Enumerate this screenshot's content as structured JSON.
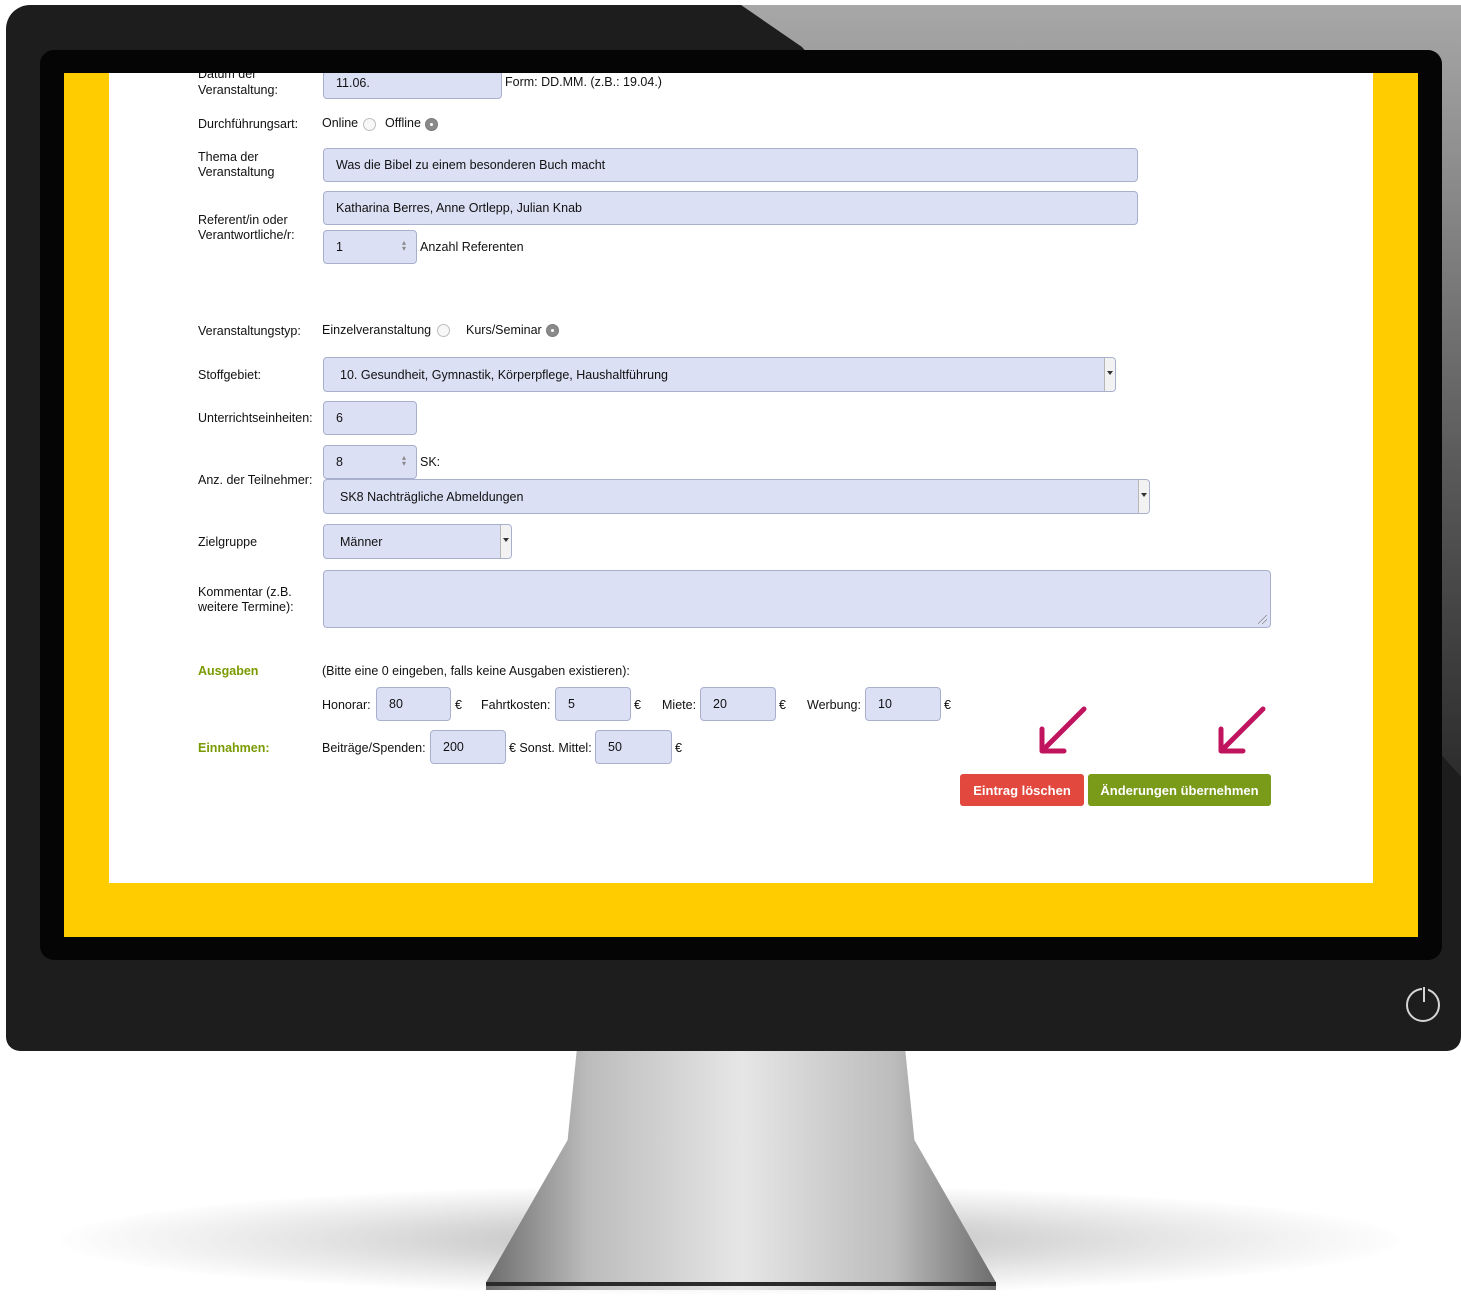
{
  "form": {
    "datum": {
      "label_top": "Datum der",
      "label_bottom": "Veranstaltung:",
      "value": "11.06.",
      "hint": "Form: DD.MM. (z.B.: 19.04.)"
    },
    "durchfuehrung": {
      "label": "Durchführungsart:",
      "option_online": "Online",
      "option_offline": "Offline",
      "selected": "Offline"
    },
    "thema": {
      "label_top": "Thema der",
      "label_bottom": "Veranstaltung",
      "value": "Was die Bibel zu einem besonderen Buch macht"
    },
    "referent": {
      "label_top": "Referent/in oder",
      "label_bottom": "Verantwortliche/r:",
      "value": "Katharina Berres, Anne Ortlepp, Julian Knab",
      "count_value": "1",
      "count_label": "Anzahl Referenten"
    },
    "veranstaltungstyp": {
      "label": "Veranstaltungstyp:",
      "option_einzel": "Einzelveranstaltung",
      "option_kurs": "Kurs/Seminar",
      "selected": "Kurs/Seminar"
    },
    "stoffgebiet": {
      "label": "Stoffgebiet:",
      "value": "10. Gesundheit, Gymnastik, Körperpflege, Haushaltführung"
    },
    "unterricht": {
      "label": "Unterrichtseinheiten:",
      "value": "6"
    },
    "teilnehmer": {
      "label": "Anz. der Teilnehmer:",
      "value": "8",
      "sk_label": "SK:",
      "sk_value": "SK8 Nachträgliche Abmeldungen"
    },
    "zielgruppe": {
      "label": "Zielgruppe",
      "value": "Männer"
    },
    "kommentar": {
      "label_top": "Kommentar (z.B.",
      "label_bottom": "weitere Termine):",
      "value": ""
    }
  },
  "ausgaben": {
    "label": "Ausgaben",
    "hint": "(Bitte eine 0 eingeben, falls keine Ausgaben existieren):",
    "currency": "€",
    "honorar_label": "Honorar:",
    "honorar": "80",
    "fahrtkosten_label": "Fahrtkosten:",
    "fahrtkosten": "5",
    "miete_label": "Miete:",
    "miete": "20",
    "werbung_label": "Werbung:",
    "werbung": "10"
  },
  "einnahmen": {
    "label": "Einnahmen:",
    "beitraege_label": "Beiträge/Spenden:",
    "beitraege": "200",
    "sonst_label": "€ Sonst. Mittel:",
    "sonst": "50",
    "currency": "€"
  },
  "buttons": {
    "delete": "Eintrag löschen",
    "apply": "Änderungen übernehmen"
  },
  "colors": {
    "screen_frame": "#ffcc00",
    "input_bg": "#dce0f5",
    "delete": "#e2483e",
    "apply": "#7a9a1a",
    "section_green": "#7a9a00",
    "arrow": "#c0145e"
  }
}
